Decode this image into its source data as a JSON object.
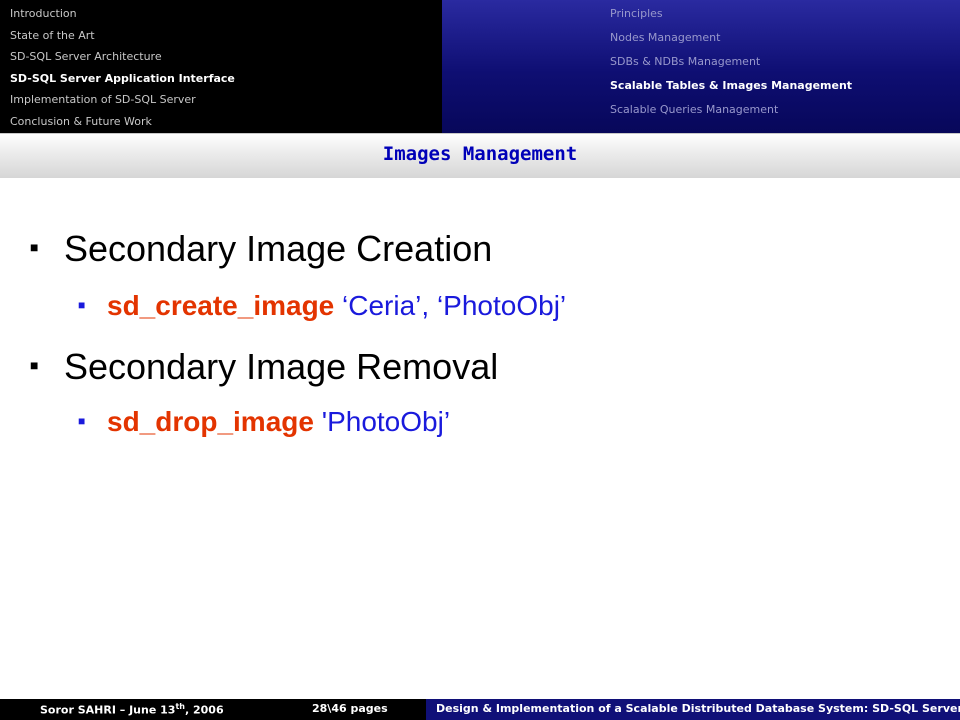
{
  "nav": {
    "left_items": [
      {
        "label": "Introduction",
        "active": false
      },
      {
        "label": "State of the Art",
        "active": false
      },
      {
        "label": "SD-SQL Server Architecture",
        "active": false
      },
      {
        "label": "SD-SQL Server Application Interface",
        "active": true
      },
      {
        "label": "Implementation of SD-SQL Server",
        "active": false
      },
      {
        "label": "Conclusion & Future Work",
        "active": false
      }
    ],
    "right_items": [
      {
        "label": "Principles",
        "active": false
      },
      {
        "label": "Nodes Management",
        "active": false
      },
      {
        "label": "SDBs & NDBs Management",
        "active": false
      },
      {
        "label": "Scalable Tables & Images Management",
        "active": true
      },
      {
        "label": "Scalable Queries Management",
        "active": false
      }
    ]
  },
  "section_title": "Images Management",
  "bullets": [
    {
      "text": "Secondary Image Creation",
      "sub": {
        "command": "sd_create_image",
        "args": " ‘Ceria’, ‘PhotoObj’"
      }
    },
    {
      "text": "Secondary Image Removal",
      "sub": {
        "command": "sd_drop_image",
        "args": " 'PhotoObj’"
      }
    }
  ],
  "footer": {
    "author_prefix": "Soror SAHRI – June 13",
    "author_sup": "th",
    "author_suffix": ", 2006",
    "pages": "28\\46 pages",
    "title": "Design & Implementation of a Scalable Distributed Database System: SD-SQL Server"
  },
  "colors": {
    "nav_left_bg": "#000000",
    "nav_right_bg": "#0e0e72",
    "title_text": "#0000b8",
    "command_text": "#e33400",
    "args_text": "#1a1adc"
  }
}
